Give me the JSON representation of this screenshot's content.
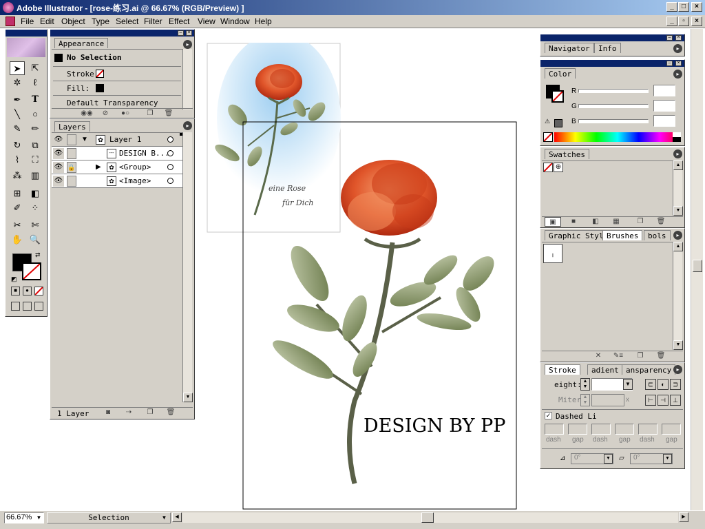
{
  "window": {
    "title": "Adobe Illustrator - [rose-练习.ai @ 66.67% (RGB/Preview) ]"
  },
  "menubar": {
    "items": [
      "File",
      "Edit",
      "Object",
      "Type",
      "Select",
      "Filter",
      "Effect",
      "View",
      "Window",
      "Help"
    ]
  },
  "appearance": {
    "tab": "Appearance",
    "title": "No Selection",
    "stroke_label": "Stroke:",
    "fill_label": "Fill:",
    "transparency": "Default Transparency"
  },
  "layers": {
    "tab": "Layers",
    "rows": [
      {
        "name": "Layer 1"
      },
      {
        "name": "DESIGN B..."
      },
      {
        "name": "<Group>"
      },
      {
        "name": "<Image>"
      }
    ],
    "footer": "1 Layer"
  },
  "navigator": {
    "tabs": [
      "Navigator",
      "Info"
    ]
  },
  "color": {
    "tab": "Color",
    "channels": [
      {
        "label": "R"
      },
      {
        "label": "G"
      },
      {
        "label": "B"
      }
    ]
  },
  "swatches": {
    "tab": "Swatches"
  },
  "brushes": {
    "tabs": [
      "Graphic Styl",
      "Brushes",
      "bols"
    ]
  },
  "stroke": {
    "tabs": [
      "Stroke",
      "adient",
      "ansparency"
    ],
    "weight_label": "eight:",
    "miter_label": "Miter",
    "miter_unit": "x",
    "dashed_label": "Dashed Li",
    "dash_labels": [
      "dash",
      "gap",
      "dash",
      "gap",
      "dash",
      "gap"
    ],
    "cap_value1": "0°",
    "cap_value2": "0°"
  },
  "artwork": {
    "card_line1": "eine Rose",
    "card_line2": "für Dich",
    "credit": "DESIGN BY PP"
  },
  "statusbar": {
    "zoom": "66.67%",
    "tool": "Selection"
  },
  "colors": {
    "titlebar_start": "#0a246a",
    "titlebar_end": "#a6caf0",
    "chrome": "#d4d0c8",
    "rose": "#e0552a",
    "leaf": "#7a8a5a"
  }
}
